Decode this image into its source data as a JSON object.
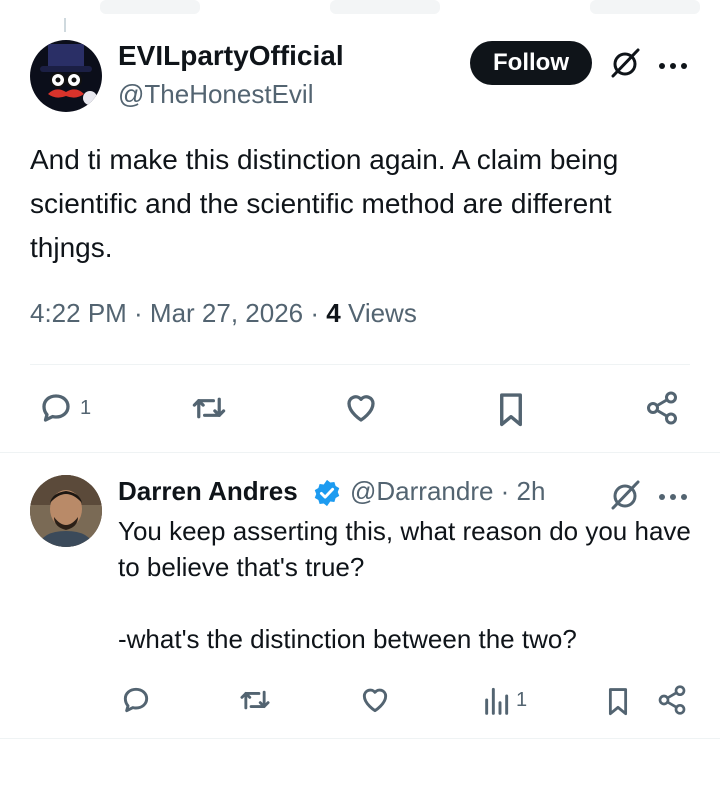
{
  "main_post": {
    "display_name": "EVILpartyOfficial",
    "handle": "@TheHonestEvil",
    "follow_label": "Follow",
    "text": "And ti make this distinction again. A claim being scientific and the scientific method are different thjngs.",
    "time": "4:22 PM · Mar 27, 2026 · ",
    "views_count": "4",
    "views_label": " Views",
    "reply_count": "1"
  },
  "reply": {
    "display_name": "Darren Andres",
    "handle_time": "@Darrandre · 2h",
    "text": "You keep asserting this, what reason do you have to believe that's true?\n\n-what's the distinction between the two?",
    "views_count": "1"
  },
  "icons": {
    "grok": "grok-icon",
    "more": "more-icon",
    "reply": "reply-icon",
    "repost": "repost-icon",
    "like": "heart-icon",
    "bookmark": "bookmark-icon",
    "share": "share-icon",
    "views": "analytics-icon",
    "verified": "verified-badge-icon"
  },
  "colors": {
    "text": "#0f1419",
    "secondary": "#536471",
    "verified": "#1d9bf0",
    "divider": "#eff3f4"
  }
}
